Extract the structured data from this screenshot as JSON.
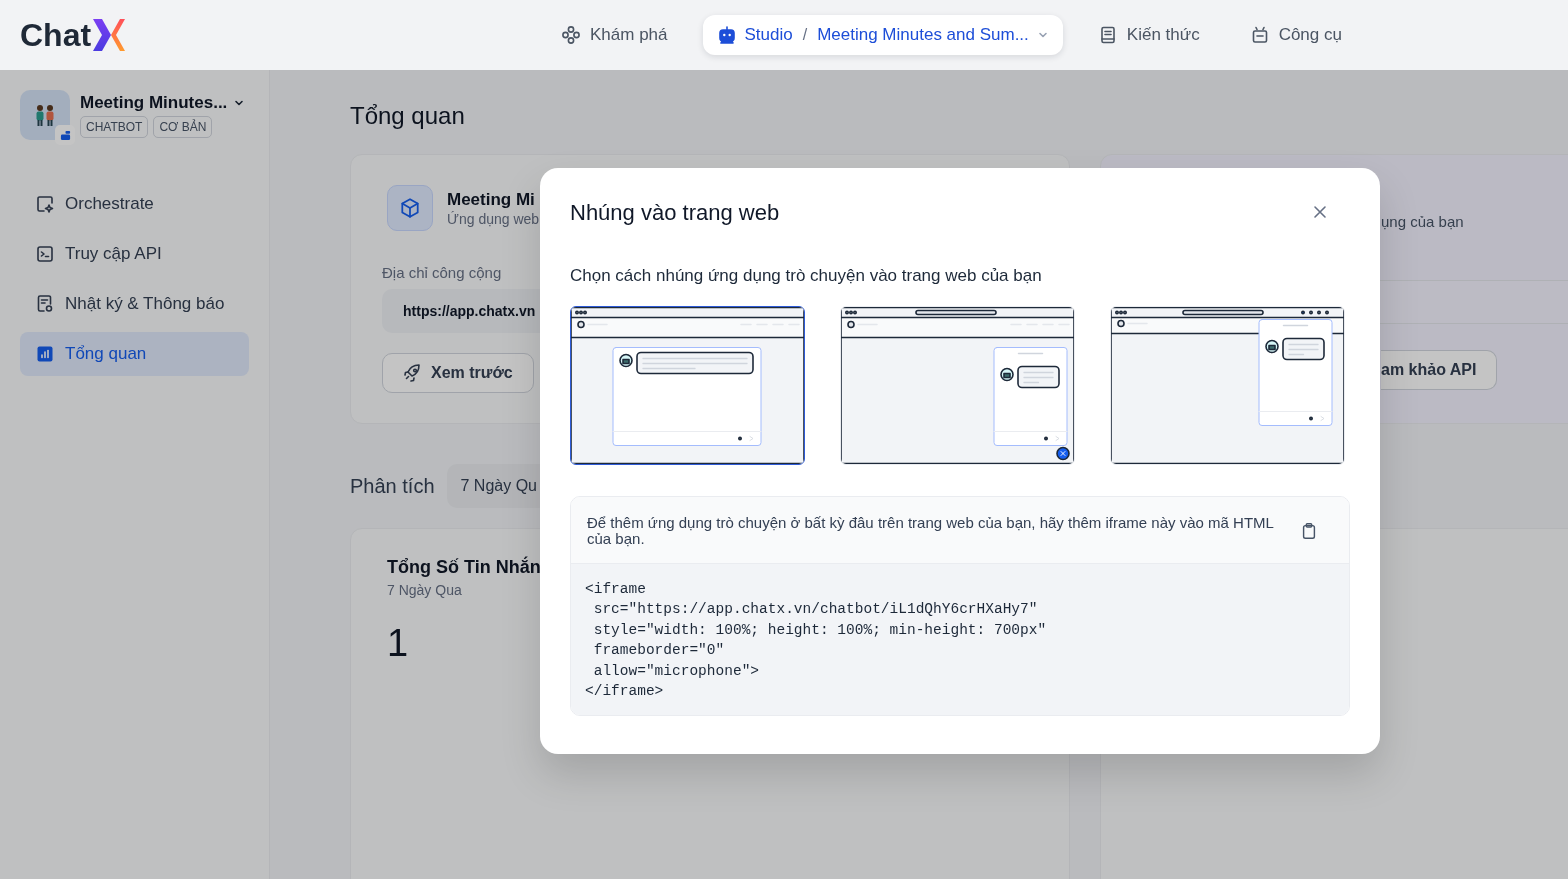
{
  "header": {
    "logo": "Chat",
    "nav": [
      {
        "kind": "explore",
        "label": "Khám phá",
        "selected": false
      },
      {
        "kind": "studio",
        "label": "Studio",
        "separator": "/",
        "app": "Meeting Minutes and Sum...",
        "selected": true
      },
      {
        "kind": "knowledge",
        "label": "Kiến thức",
        "selected": false
      },
      {
        "kind": "tools",
        "label": "Công cụ",
        "selected": false
      }
    ]
  },
  "sidebar": {
    "app": {
      "name": "Meeting Minutes...",
      "tags": [
        "CHATBOT",
        "CƠ BẢN"
      ]
    },
    "items": [
      {
        "kind": "orchestrate",
        "label": "Orchestrate",
        "selected": false
      },
      {
        "kind": "api",
        "label": "Truy cập API",
        "selected": false
      },
      {
        "kind": "logs",
        "label": "Nhật ký & Thông báo",
        "selected": false
      },
      {
        "kind": "overview",
        "label": "Tổng quan",
        "selected": true
      }
    ]
  },
  "main": {
    "title": "Tổng quan",
    "webapp_card": {
      "name": "Meeting Mi",
      "type": "Ứng dụng web",
      "field_label": "Địa chỉ công cộng",
      "url": "https://app.chatx.vn",
      "preview_button": "Xem trước"
    },
    "api_card": {
      "subtitle": "ụng của bạn",
      "button": "am khảo API"
    },
    "analytics": {
      "label": "Phân tích",
      "period": "7 Ngày Qu"
    },
    "stat_card": {
      "title": "Tổng Số Tin Nhắn",
      "period": "7 Ngày Qua",
      "value": "1"
    }
  },
  "modal": {
    "title": "Nhúng vào trang web",
    "subtitle": "Chọn cách nhúng ứng dụng trò chuyện vào trang web của bạn",
    "options": [
      {
        "kind": "full",
        "selected": true
      },
      {
        "kind": "bubble",
        "selected": false
      },
      {
        "kind": "docked",
        "selected": false
      }
    ],
    "instruction": "Để thêm ứng dụng trò chuyện ở bất kỳ đâu trên trang web của bạn, hãy thêm iframe này vào mã HTML của bạn.",
    "code": [
      "<iframe",
      " src=\"https://app.chatx.vn/chatbot/iL1dQhY6crHXaHy7\"",
      " style=\"width: 100%; height: 100%; min-height: 700px\"",
      " frameborder=\"0\"",
      " allow=\"microphone\">",
      "</iframe>"
    ]
  }
}
